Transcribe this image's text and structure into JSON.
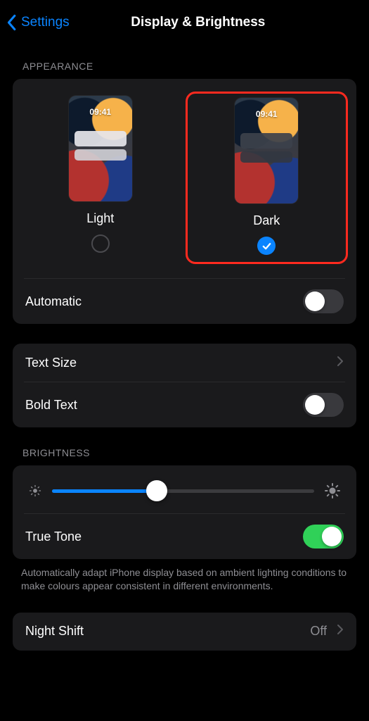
{
  "nav": {
    "back_label": "Settings",
    "title": "Display & Brightness"
  },
  "appearance": {
    "header": "APPEARANCE",
    "preview_time": "09:41",
    "light_label": "Light",
    "dark_label": "Dark",
    "selected": "dark",
    "automatic_label": "Automatic",
    "automatic_on": false
  },
  "text_section": {
    "text_size_label": "Text Size",
    "bold_text_label": "Bold Text",
    "bold_text_on": false
  },
  "brightness": {
    "header": "BRIGHTNESS",
    "value_percent": 40,
    "true_tone_label": "True Tone",
    "true_tone_on": true,
    "true_tone_footnote": "Automatically adapt iPhone display based on ambient lighting conditions to make colours appear consistent in different environments."
  },
  "night_shift": {
    "label": "Night Shift",
    "value": "Off"
  },
  "colors": {
    "accent": "#0a84ff",
    "green": "#30d158",
    "highlight": "#ff2a1f"
  }
}
